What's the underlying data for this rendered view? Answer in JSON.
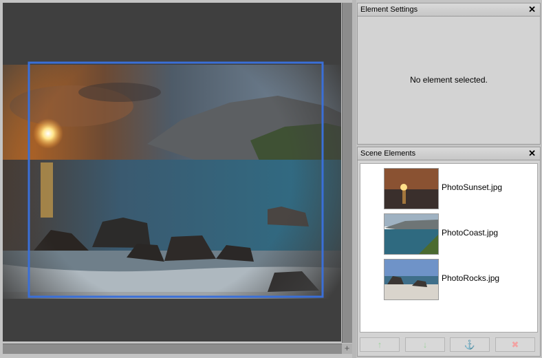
{
  "element_settings": {
    "title": "Element Settings",
    "empty_message": "No element selected."
  },
  "scene_elements": {
    "title": "Scene Elements",
    "items": [
      {
        "label": "PhotoSunset.jpg",
        "thumb": "sunset"
      },
      {
        "label": "PhotoCoast.jpg",
        "thumb": "coast"
      },
      {
        "label": "PhotoRocks.jpg",
        "thumb": "rocks"
      }
    ],
    "buttons": [
      {
        "name": "move-up",
        "glyph": "↑",
        "icon": "arrow-up-icon",
        "enabled": false
      },
      {
        "name": "move-down",
        "glyph": "↓",
        "icon": "arrow-down-icon",
        "enabled": false
      },
      {
        "name": "anchor",
        "glyph": "⚓",
        "icon": "anchor-icon",
        "enabled": false
      },
      {
        "name": "delete",
        "glyph": "✖",
        "icon": "delete-icon",
        "enabled": false
      }
    ]
  },
  "close_glyph": "✕",
  "corner_glyph": "+",
  "colors": {
    "selection": "#3a6fd8",
    "canvas_bg": "#3f3f3f",
    "button_up_down": "#9fd39f",
    "button_anchor": "#cfcfcf",
    "button_delete": "#f2a3a3"
  }
}
